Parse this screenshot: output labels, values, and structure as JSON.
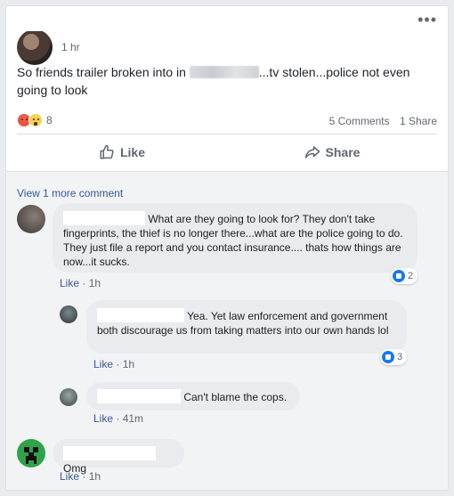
{
  "post": {
    "time": "1 hr",
    "text_before": "So friends trailer broken into in ",
    "text_after": "...tv stolen...police not even going to look",
    "reaction_count": "8",
    "comments_count": "5 Comments",
    "shares_count": "1 Share",
    "reactions": [
      "angry-reaction-icon",
      "wow-reaction-icon"
    ]
  },
  "actions": {
    "like_label": "Like",
    "share_label": "Share"
  },
  "view_more_comments": "View 1 more comment",
  "comments": [
    {
      "text": "What are they going to look for? They don't take fingerprints, the thief is no longer there...what are the police going to do. They just file a report and you contact insurance.... thats how things are now...it sucks.",
      "like_label": "Like",
      "time": "1h",
      "like_count": "2"
    },
    {
      "text": "Yea. Yet law enforcement and government both discourage us from taking matters into our own hands lol",
      "like_label": "Like",
      "time": "1h",
      "like_count": "3"
    },
    {
      "text": "Can't blame the cops.",
      "like_label": "Like",
      "time": "41m"
    },
    {
      "text": "Omg",
      "like_label": "Like",
      "time": "1h"
    }
  ],
  "colors": {
    "link": "#385898",
    "like_badge": "#1877f2",
    "bubble": "#e9ebee"
  }
}
